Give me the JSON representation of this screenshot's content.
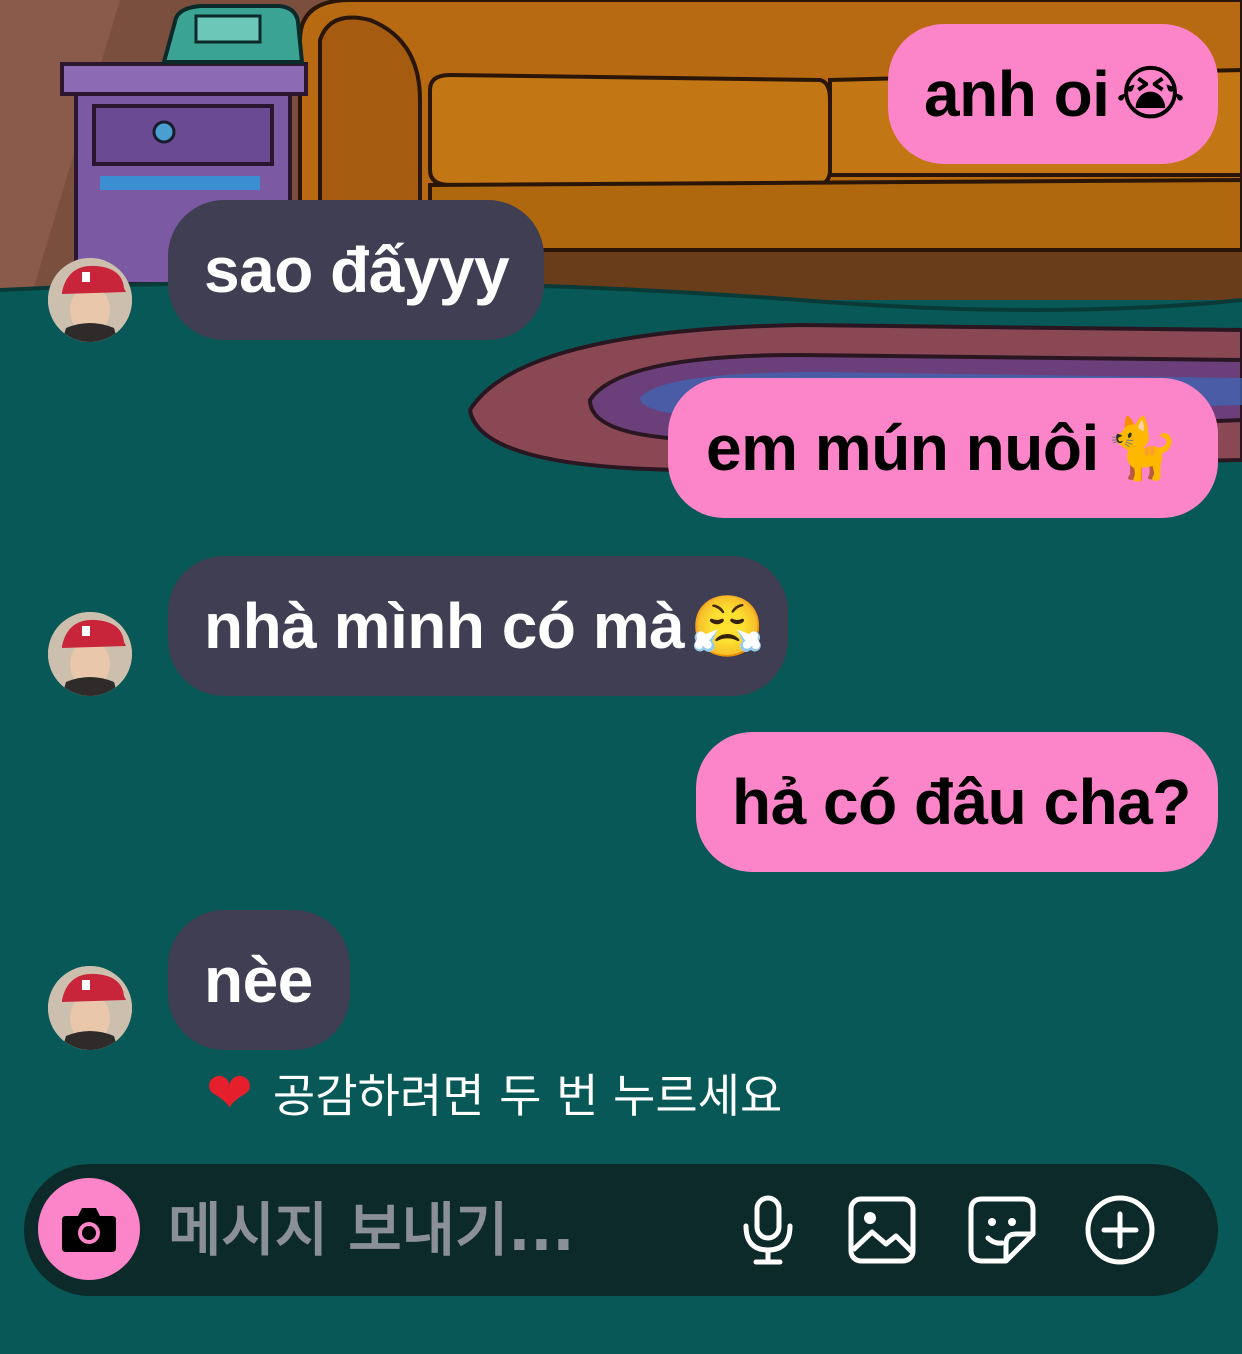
{
  "messages": [
    {
      "direction": "outgoing",
      "text": "anh oi",
      "emoji": "😭"
    },
    {
      "direction": "incoming",
      "text": "sao đấyyy",
      "emoji": ""
    },
    {
      "direction": "outgoing",
      "text": "em mún nuôi ",
      "emoji": "🐈"
    },
    {
      "direction": "incoming",
      "text": "nhà mình có mà",
      "emoji": "😤"
    },
    {
      "direction": "outgoing",
      "text": "hả có đâu cha?",
      "emoji": ""
    },
    {
      "direction": "incoming",
      "text": "nèe",
      "emoji": ""
    }
  ],
  "reaction_hint": {
    "icon": "heart-icon",
    "text": "공감하려면 두 번 누르세요"
  },
  "composer": {
    "placeholder": "메시지 보내기...",
    "icons": [
      "camera-icon",
      "microphone-icon",
      "gallery-icon",
      "sticker-icon",
      "plus-circle-icon"
    ]
  },
  "colors": {
    "outgoing_bubble": "#fc84c8",
    "incoming_bubble": "#3f3e52",
    "background": "#075856",
    "composer": "#0c2a29"
  }
}
